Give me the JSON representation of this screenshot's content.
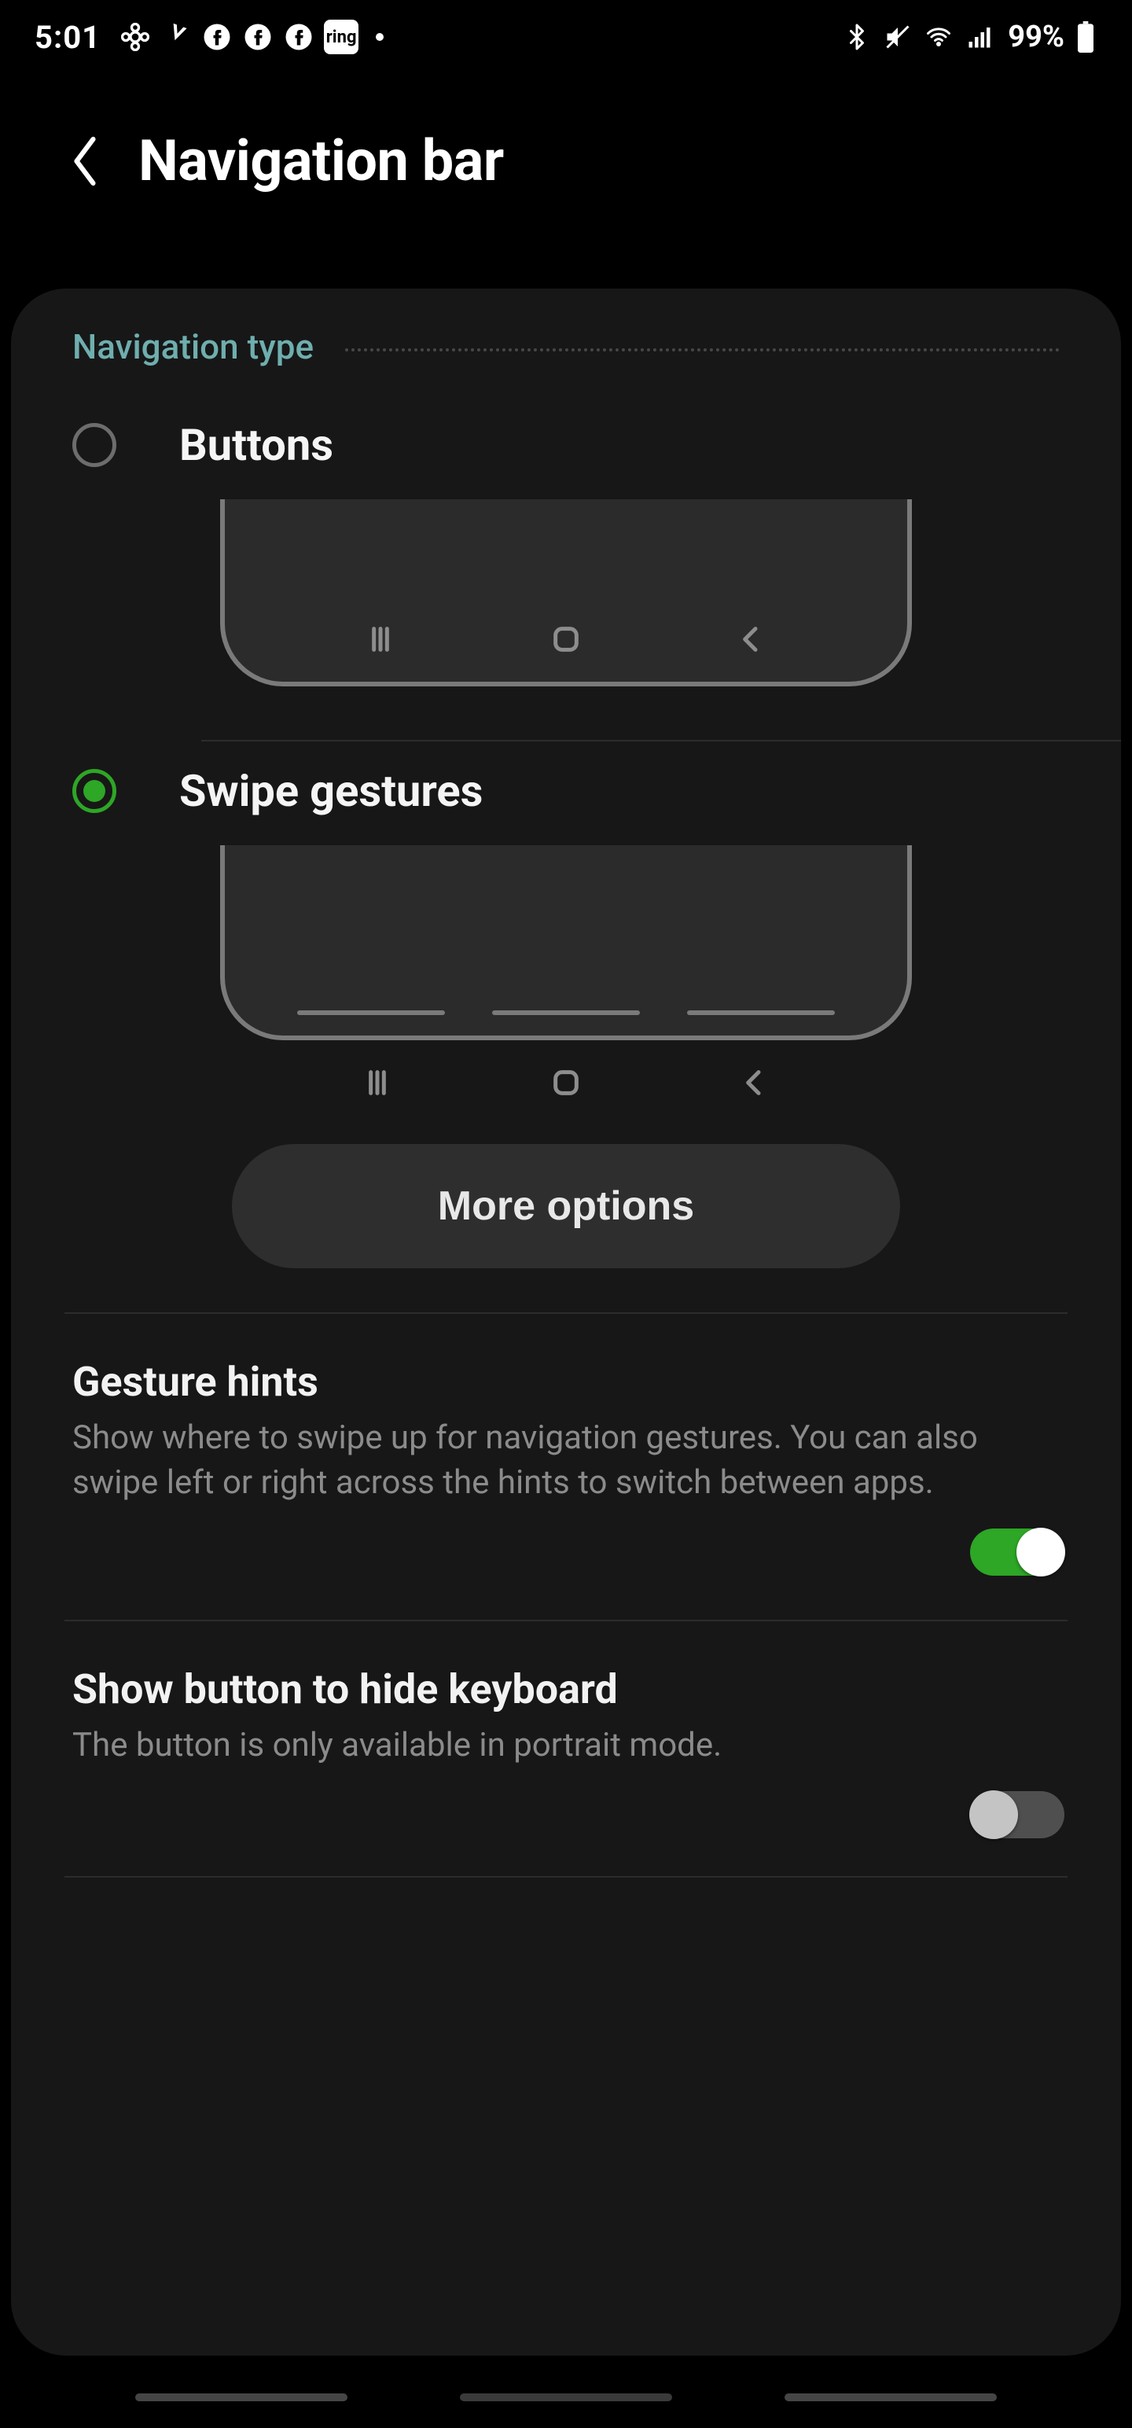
{
  "status_bar": {
    "clock": "5:01",
    "battery_pct": "99%",
    "ring_label": "ring"
  },
  "header": {
    "title": "Navigation bar"
  },
  "section": {
    "title": "Navigation type"
  },
  "options": {
    "buttons": {
      "label": "Buttons",
      "selected": false
    },
    "gestures": {
      "label": "Swipe gestures",
      "selected": true
    },
    "more_options_label": "More options"
  },
  "settings": {
    "gesture_hints": {
      "title": "Gesture hints",
      "desc": "Show where to swipe up for navigation gestures. You can also swipe left or right across the hints to switch between apps.",
      "enabled": true
    },
    "show_kb_button": {
      "title": "Show button to hide keyboard",
      "desc": "The button is only available in portrait mode.",
      "enabled": false
    }
  }
}
